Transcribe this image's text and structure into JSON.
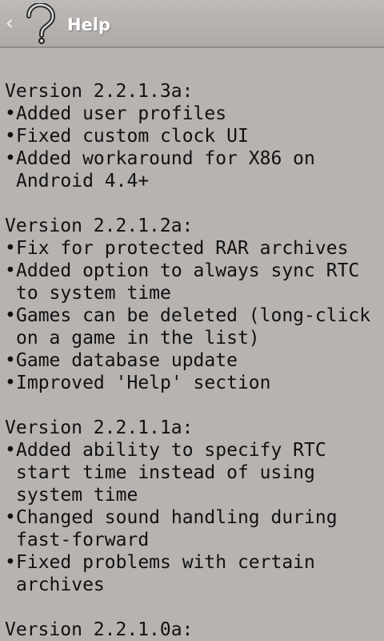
{
  "action_bar": {
    "title": "Help",
    "back_glyph": "‹",
    "icon": "question-mark-icon"
  },
  "versions": [
    {
      "title": "Version 2.2.1.3a:",
      "items": [
        "Added user profiles",
        "Fixed custom clock UI",
        "Added workaround for X86 on Android 4.4+"
      ]
    },
    {
      "title": "Version 2.2.1.2a:",
      "items": [
        "Fix for protected RAR archives",
        "Added option to always sync RTC to system time",
        "Games can be deleted (long-click on a game in the list)",
        "Game database update",
        "Improved 'Help' section"
      ]
    },
    {
      "title": "Version 2.2.1.1a:",
      "items": [
        "Added ability to specify RTC start time instead of using system time",
        "Changed sound handling during fast-forward",
        "Fixed problems with certain archives"
      ]
    },
    {
      "title": "Version 2.2.1.0a:",
      "items": []
    }
  ],
  "bullet": "•",
  "colors": {
    "background": "#b7b3b1",
    "text": "#111111",
    "title_text": "#ffffff"
  }
}
